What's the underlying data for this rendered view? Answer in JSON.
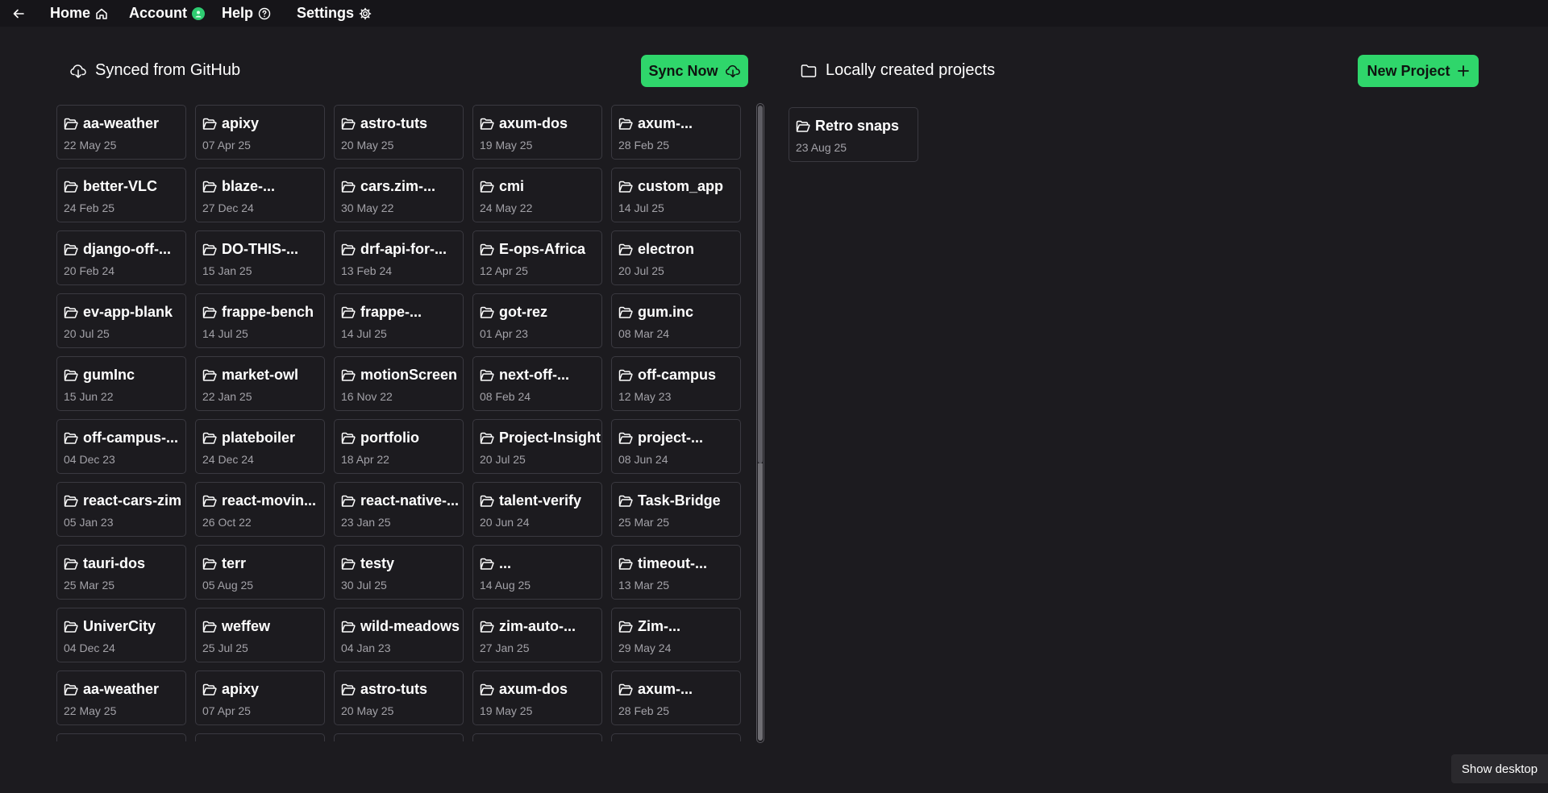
{
  "nav": {
    "home": "Home",
    "account": "Account",
    "help": "Help",
    "settings": "Settings"
  },
  "synced": {
    "title": "Synced from GitHub",
    "sync_button": "Sync Now",
    "projects": [
      {
        "name": "aa-weather",
        "date": "22 May 25"
      },
      {
        "name": "apixy",
        "date": "07 Apr 25"
      },
      {
        "name": "astro-tuts",
        "date": "20 May 25"
      },
      {
        "name": "axum-dos",
        "date": "19 May 25"
      },
      {
        "name": "axum-...",
        "date": "28 Feb 25"
      },
      {
        "name": "better-VLC",
        "date": "24 Feb 25"
      },
      {
        "name": "blaze-...",
        "date": "27 Dec 24"
      },
      {
        "name": "cars.zim-...",
        "date": "30 May 22"
      },
      {
        "name": "cmi",
        "date": "24 May 22"
      },
      {
        "name": "custom_app",
        "date": "14 Jul 25"
      },
      {
        "name": "django-off-...",
        "date": "20 Feb 24"
      },
      {
        "name": "DO-THIS-...",
        "date": "15 Jan 25"
      },
      {
        "name": "drf-api-for-...",
        "date": "13 Feb 24"
      },
      {
        "name": "E-ops-Africa",
        "date": "12 Apr 25"
      },
      {
        "name": "electron",
        "date": "20 Jul 25"
      },
      {
        "name": "ev-app-blank",
        "date": "20 Jul 25"
      },
      {
        "name": "frappe-bench",
        "date": "14 Jul 25"
      },
      {
        "name": "frappe-...",
        "date": "14 Jul 25"
      },
      {
        "name": "got-rez",
        "date": "01 Apr 23"
      },
      {
        "name": "gum.inc",
        "date": "08 Mar 24"
      },
      {
        "name": "gumInc",
        "date": "15 Jun 22"
      },
      {
        "name": "market-owl",
        "date": "22 Jan 25"
      },
      {
        "name": "motionScreen",
        "date": "16 Nov 22"
      },
      {
        "name": "next-off-...",
        "date": "08 Feb 24"
      },
      {
        "name": "off-campus",
        "date": "12 May 23"
      },
      {
        "name": "off-campus-...",
        "date": "04 Dec 23"
      },
      {
        "name": "plateboiler",
        "date": "24 Dec 24"
      },
      {
        "name": "portfolio",
        "date": "18 Apr 22"
      },
      {
        "name": "Project-Insight",
        "date": "20 Jul 25"
      },
      {
        "name": "project-...",
        "date": "08 Jun 24"
      },
      {
        "name": "react-cars-zim",
        "date": "05 Jan 23"
      },
      {
        "name": "react-movin...",
        "date": "26 Oct 22"
      },
      {
        "name": "react-native-...",
        "date": "23 Jan 25"
      },
      {
        "name": "talent-verify",
        "date": "20 Jun 24"
      },
      {
        "name": "Task-Bridge",
        "date": "25 Mar 25"
      },
      {
        "name": "tauri-dos",
        "date": "25 Mar 25"
      },
      {
        "name": "terr",
        "date": "05 Aug 25"
      },
      {
        "name": "testy",
        "date": "30 Jul 25"
      },
      {
        "name": "...",
        "date": "14 Aug 25"
      },
      {
        "name": "timeout-...",
        "date": "13 Mar 25"
      },
      {
        "name": "UniverCity",
        "date": "04 Dec 24"
      },
      {
        "name": "weffew",
        "date": "25 Jul 25"
      },
      {
        "name": "wild-meadows",
        "date": "04 Jan 23"
      },
      {
        "name": "zim-auto-...",
        "date": "27 Jan 25"
      },
      {
        "name": "Zim-...",
        "date": "29 May 24"
      },
      {
        "name": "aa-weather",
        "date": "22 May 25"
      },
      {
        "name": "apixy",
        "date": "07 Apr 25"
      },
      {
        "name": "astro-tuts",
        "date": "20 May 25"
      },
      {
        "name": "axum-dos",
        "date": "19 May 25"
      },
      {
        "name": "axum-...",
        "date": "28 Feb 25"
      },
      {
        "name": "",
        "date": ""
      },
      {
        "name": "",
        "date": ""
      },
      {
        "name": "",
        "date": ""
      },
      {
        "name": "",
        "date": ""
      },
      {
        "name": "",
        "date": ""
      }
    ]
  },
  "local": {
    "title": "Locally created projects",
    "new_button": "New Project",
    "projects": [
      {
        "name": "Retro snaps",
        "date": "23 Aug 25"
      }
    ]
  },
  "taskbar": {
    "show_desktop": "Show desktop"
  },
  "colors": {
    "background": "#1c1b1f",
    "accent_green": "#2fd66b",
    "card_border": "#3a3940"
  }
}
